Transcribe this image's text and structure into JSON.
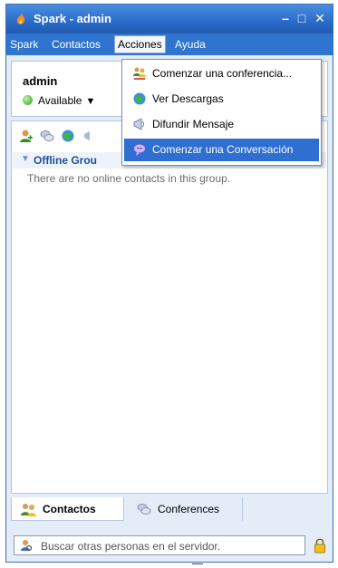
{
  "window": {
    "title": "Spark - admin"
  },
  "menubar": {
    "items": [
      "Spark",
      "Contactos",
      "Acciones",
      "Ayuda"
    ]
  },
  "user": {
    "name": "admin",
    "status": "Available"
  },
  "group": {
    "name": "Offline Group",
    "visible_name": "Offline Grou",
    "empty_message": "There are no online contacts in this group."
  },
  "menu_acciones": {
    "items": [
      {
        "label": "Comenzar una conferencia...",
        "icon": "conference-icon"
      },
      {
        "label": "Ver Descargas",
        "icon": "downloads-icon"
      },
      {
        "label": "Difundir Mensaje",
        "icon": "broadcast-icon"
      },
      {
        "label": "Comenzar una Conversación",
        "icon": "chat-icon",
        "highlighted": true
      }
    ]
  },
  "tabs": {
    "contacts": "Contactos",
    "conferences": "Conferences"
  },
  "search": {
    "placeholder": "Buscar otras personas en el servidor."
  },
  "colors": {
    "titlebar": "#2a6bc8",
    "menubar": "#2f74cf",
    "highlight": "#2f6fd1",
    "group_text": "#1f4d9a"
  }
}
